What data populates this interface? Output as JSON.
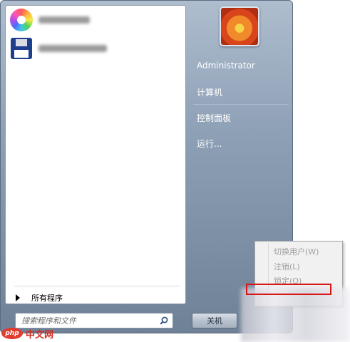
{
  "left_pane": {
    "programs": [
      {
        "icon": "colorwheel-icon",
        "label": ""
      },
      {
        "icon": "floppy-icon",
        "label": ""
      }
    ],
    "all_programs_label": "所有程序",
    "search_placeholder": "搜索程序和文件"
  },
  "right_pane": {
    "items": [
      {
        "label": "Administrator"
      },
      {
        "label": "计算机"
      },
      {
        "label": "控制面板"
      },
      {
        "label": "运行..."
      }
    ],
    "shutdown_label": "关机"
  },
  "popup_menu": {
    "items": [
      {
        "label": "切换用户(W)"
      },
      {
        "label": "注销(L)"
      },
      {
        "label": "锁定(O)"
      }
    ]
  },
  "watermark": {
    "logo_text": "php",
    "text": "中文网"
  },
  "colors": {
    "accent_red": "#d61818",
    "panel_blue": "#8ea0b6"
  }
}
